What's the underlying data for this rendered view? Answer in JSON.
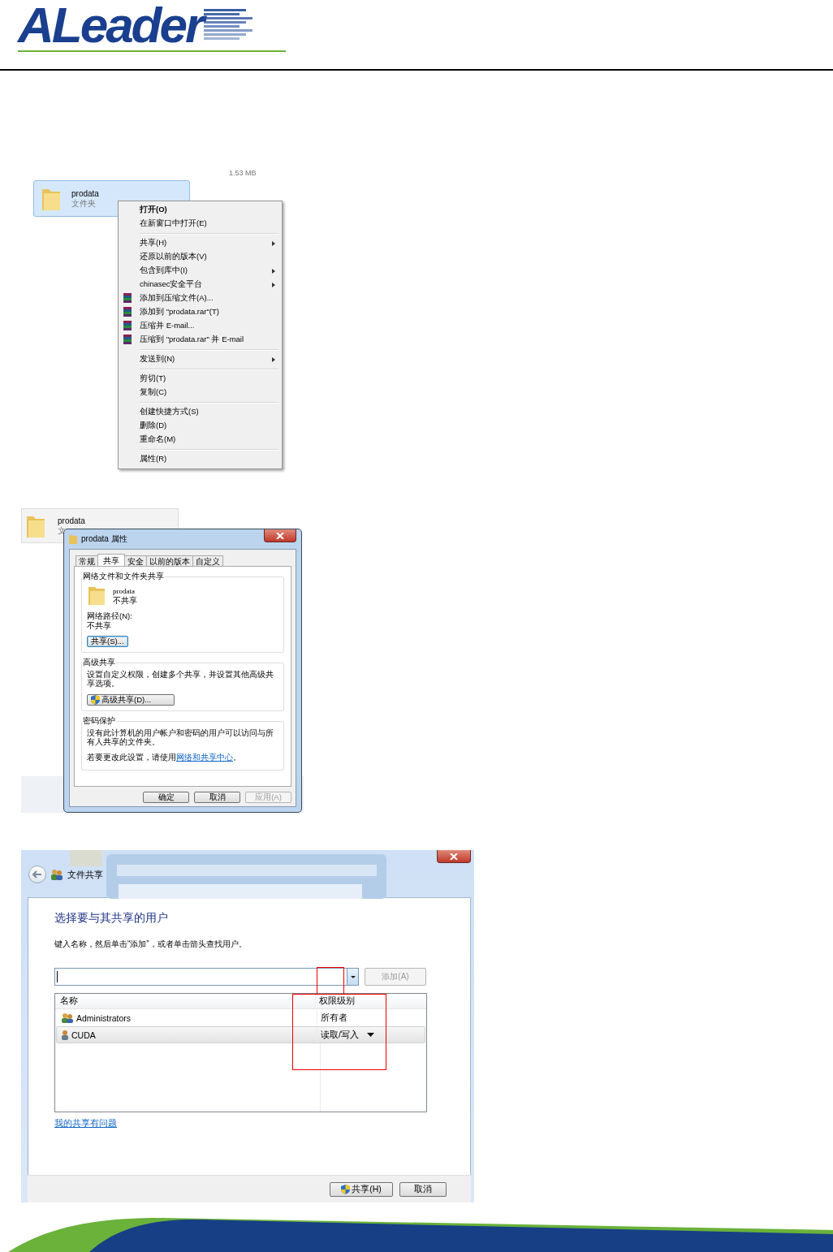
{
  "header": {
    "logo": "ALeader"
  },
  "context_menu_shot": {
    "size_label": "1.53 MB",
    "folder": {
      "name": "prodata",
      "type": "文件夹",
      "selected": true
    },
    "menu": [
      [
        {
          "label": "打开(O)",
          "kind": "default"
        },
        {
          "label": "在新窗口中打开(E)",
          "kind": "plain"
        }
      ],
      [
        {
          "label": "共享(H)",
          "kind": "submenu"
        },
        {
          "label": "还原以前的版本(V)",
          "kind": "plain"
        },
        {
          "label": "包含到库中(I)",
          "kind": "submenu"
        },
        {
          "label": "chinasec安全平台",
          "kind": "submenu"
        },
        {
          "label": "添加到压缩文件(A)...",
          "kind": "archive"
        },
        {
          "label": "添加到 \"prodata.rar\"(T)",
          "kind": "archive"
        },
        {
          "label": "压缩并 E-mail...",
          "kind": "archive"
        },
        {
          "label": "压缩到 \"prodata.rar\" 并 E-mail",
          "kind": "archive"
        }
      ],
      [
        {
          "label": "发送到(N)",
          "kind": "submenu"
        }
      ],
      [
        {
          "label": "剪切(T)",
          "kind": "plain"
        },
        {
          "label": "复制(C)",
          "kind": "plain"
        }
      ],
      [
        {
          "label": "创建快捷方式(S)",
          "kind": "plain"
        },
        {
          "label": "删除(D)",
          "kind": "plain"
        },
        {
          "label": "重命名(M)",
          "kind": "plain"
        }
      ],
      [
        {
          "label": "属性(R)",
          "kind": "plain"
        }
      ]
    ]
  },
  "properties_shot": {
    "folder": {
      "name": "prodata",
      "type": "文"
    },
    "dialog": {
      "title": "prodata 属性",
      "tabs": [
        {
          "label": "常规",
          "selected": false
        },
        {
          "label": "共享",
          "selected": true
        },
        {
          "label": "安全",
          "selected": false
        },
        {
          "label": "以前的版本",
          "selected": false
        },
        {
          "label": "自定义",
          "selected": false
        }
      ],
      "network_group": {
        "title": "网络文件和文件夹共享",
        "folder_name": "prodata",
        "status": "不共享",
        "path_label": "网络路径(N):",
        "path_value": "不共享",
        "button": "共享(S)..."
      },
      "advanced_group": {
        "title": "高级共享",
        "text": "设置自定义权限，创建多个共享，并设置其他高级共享选项。",
        "button": "高级共享(D)..."
      },
      "password_group": {
        "title": "密码保护",
        "text": "没有此计算机的用户帐户和密码的用户可以访问与所有人共享的文件夹。",
        "change_prefix": "若要更改此设置，请使用",
        "change_link": "网络和共享中心",
        "change_suffix": "。"
      },
      "buttons": [
        {
          "label": "确定",
          "disabled": false
        },
        {
          "label": "取消",
          "disabled": false
        },
        {
          "label": "应用(A)",
          "disabled": true
        }
      ]
    }
  },
  "sharing_shot": {
    "title": "文件共享",
    "heading": "选择要与其共享的用户",
    "instruction": "键入名称，然后单击“添加”，或者单击箭头查找用户。",
    "add_button": {
      "label": "添加(A)",
      "disabled": true
    },
    "columns": [
      "名称",
      "权限级别"
    ],
    "rows": [
      {
        "name": "Administrators",
        "kind": "group",
        "permission": "所有者",
        "selected": false
      },
      {
        "name": "CUDA",
        "kind": "user",
        "permission": "读取/写入",
        "selected": true
      }
    ],
    "help_link": "我的共享有问题",
    "buttons": [
      {
        "label": "共享(H)",
        "shield": true
      },
      {
        "label": "取消",
        "shield": false
      }
    ]
  }
}
